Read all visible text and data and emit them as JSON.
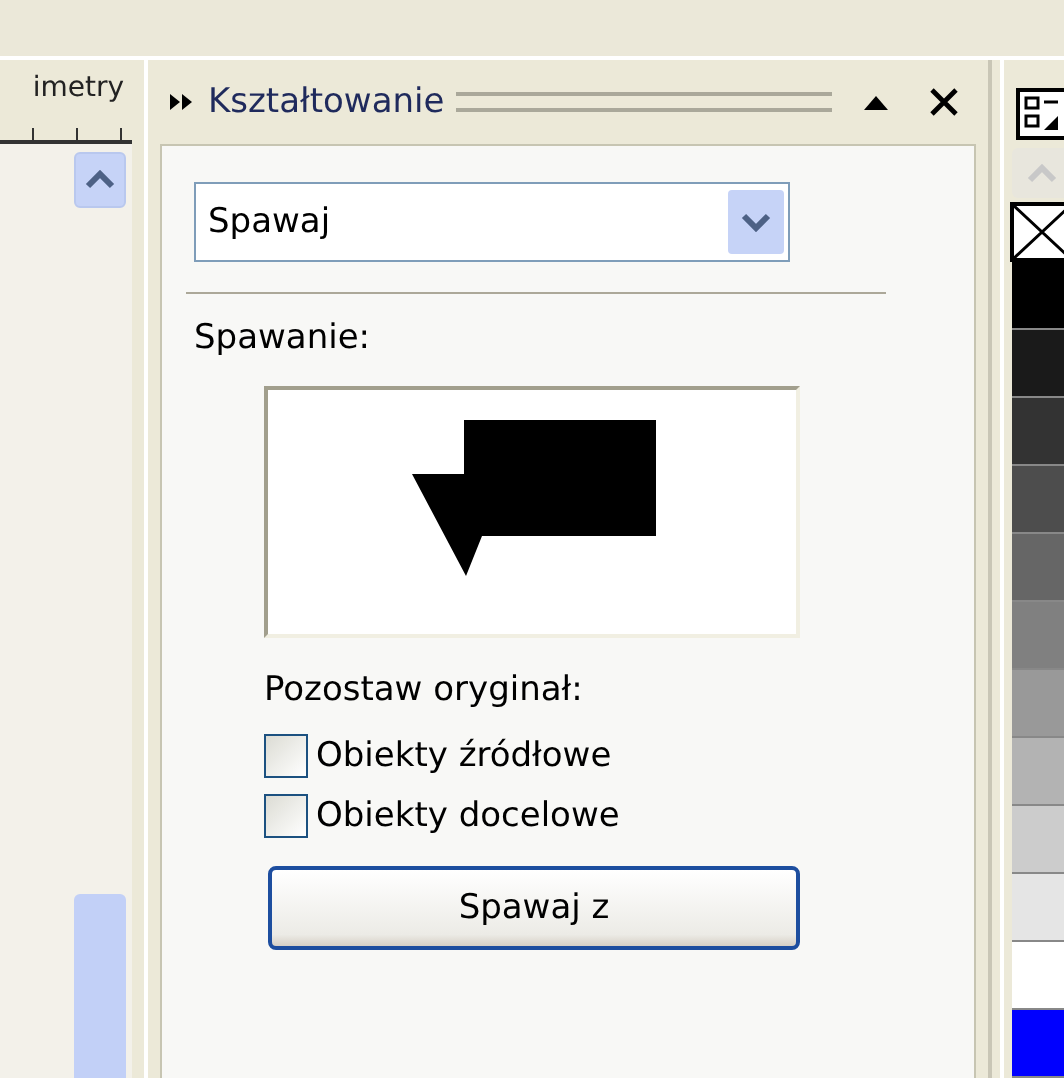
{
  "left_panel": {
    "ruler_label": "imetry"
  },
  "docker": {
    "title": "Kształtowanie",
    "mode": {
      "value": "Spawaj"
    },
    "section_label": "Spawanie:",
    "keep_label": "Pozostaw oryginał:",
    "options": [
      {
        "label": "Obiekty źródłowe",
        "checked": false
      },
      {
        "label": "Obiekty docelowe",
        "checked": false
      }
    ],
    "apply_button": "Spawaj z"
  },
  "palette": {
    "swatches": [
      {
        "color": "#000000"
      },
      {
        "color": "#1a1a1a"
      },
      {
        "color": "#333333"
      },
      {
        "color": "#4d4d4d"
      },
      {
        "color": "#666666"
      },
      {
        "color": "#808080"
      },
      {
        "color": "#999999"
      },
      {
        "color": "#b3b3b3"
      },
      {
        "color": "#cccccc"
      },
      {
        "color": "#e5e5e5"
      },
      {
        "color": "#ffffff"
      },
      {
        "color": "#0000ff"
      }
    ]
  }
}
